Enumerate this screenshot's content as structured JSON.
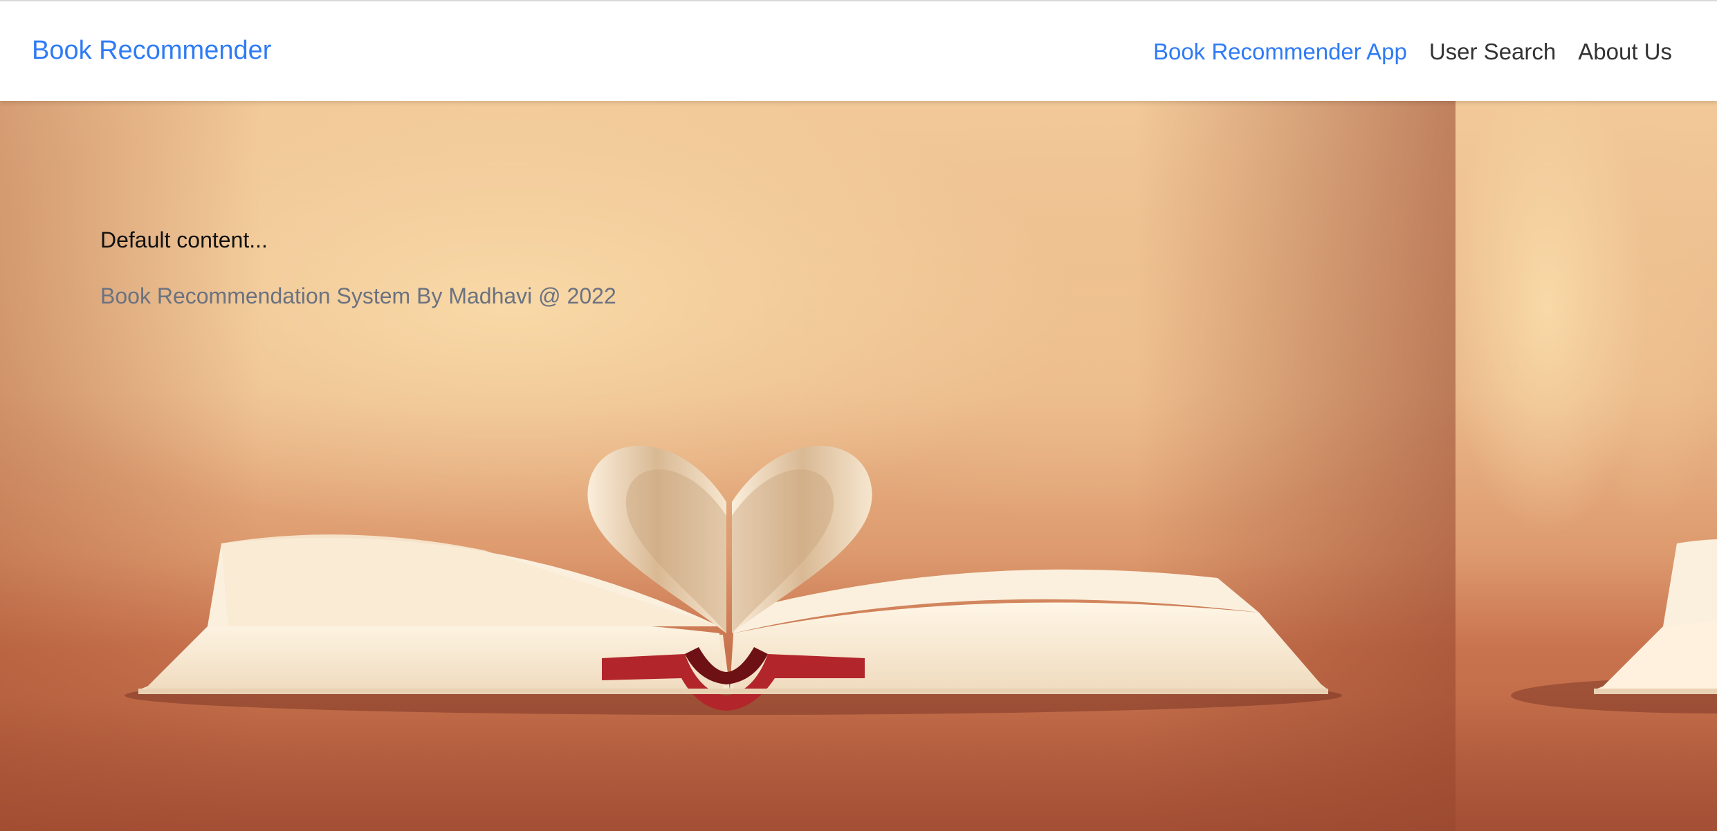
{
  "navbar": {
    "brand": "Book Recommender",
    "links": [
      {
        "label": "Book Recommender App",
        "active": true
      },
      {
        "label": "User Search",
        "active": false
      },
      {
        "label": "About Us",
        "active": false
      }
    ]
  },
  "main": {
    "default_content": "Default content...",
    "footer": "Book Recommendation System By Madhavi @ 2022"
  },
  "colors": {
    "brand_blue": "#2f7bf5",
    "nav_text": "#333333",
    "muted_text": "#6b7280"
  }
}
